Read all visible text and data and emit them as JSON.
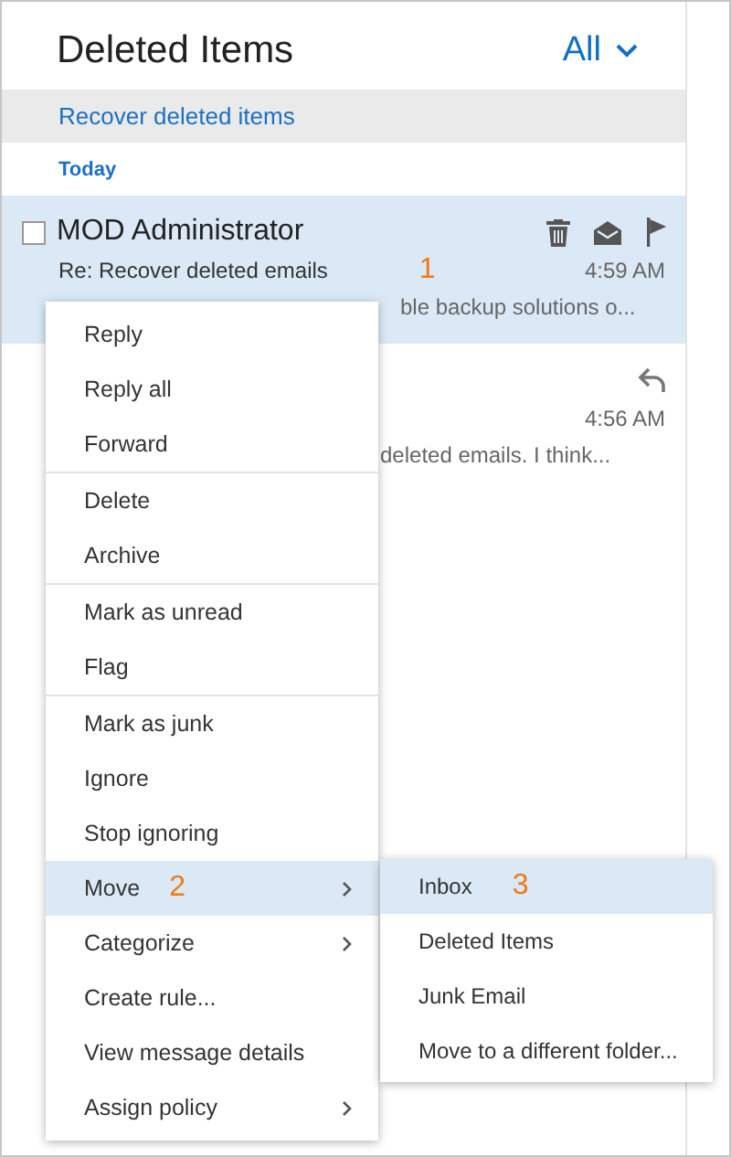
{
  "header": {
    "title": "Deleted Items",
    "filter": "All"
  },
  "recover_link": "Recover deleted items",
  "group_label": "Today",
  "messages": [
    {
      "sender": "MOD Administrator",
      "subject": "Re: Recover deleted emails",
      "preview": "ble backup solutions o...",
      "time": "4:59 AM",
      "selected": true,
      "checked": false,
      "annotation": "1",
      "actions": [
        {
          "kind": "delete"
        },
        {
          "kind": "mark-read"
        },
        {
          "kind": "flag"
        }
      ]
    },
    {
      "preview": "deleted emails. I think...",
      "time": "4:56 AM",
      "selected": false,
      "actions": [
        {
          "kind": "replied"
        }
      ]
    }
  ],
  "context_menu": {
    "groups": [
      {
        "items": [
          {
            "label": "Reply",
            "selected": false,
            "submenu": false
          },
          {
            "label": "Reply all",
            "selected": false,
            "submenu": false
          },
          {
            "label": "Forward",
            "selected": false,
            "submenu": false
          }
        ]
      },
      {
        "items": [
          {
            "label": "Delete",
            "selected": false,
            "submenu": false
          },
          {
            "label": "Archive",
            "selected": false,
            "submenu": false
          }
        ]
      },
      {
        "items": [
          {
            "label": "Mark as unread",
            "selected": false,
            "submenu": false
          },
          {
            "label": "Flag",
            "selected": false,
            "submenu": false
          }
        ]
      },
      {
        "items": [
          {
            "label": "Mark as junk",
            "selected": false,
            "submenu": false
          },
          {
            "label": "Ignore",
            "selected": false,
            "submenu": false
          },
          {
            "label": "Stop ignoring",
            "selected": false,
            "submenu": false
          },
          {
            "label": "Move",
            "selected": true,
            "submenu": true,
            "annotation": "2"
          },
          {
            "label": "Categorize",
            "selected": false,
            "submenu": true
          },
          {
            "label": "Create rule...",
            "selected": false,
            "submenu": false
          },
          {
            "label": "View message details",
            "selected": false,
            "submenu": false
          },
          {
            "label": "Assign policy",
            "selected": false,
            "submenu": true
          }
        ]
      }
    ]
  },
  "submenu": {
    "items": [
      {
        "label": "Inbox",
        "selected": true,
        "annotation": "3"
      },
      {
        "label": "Deleted Items",
        "selected": false
      },
      {
        "label": "Junk Email",
        "selected": false
      },
      {
        "label": "Move to a different folder...",
        "selected": false
      }
    ]
  }
}
